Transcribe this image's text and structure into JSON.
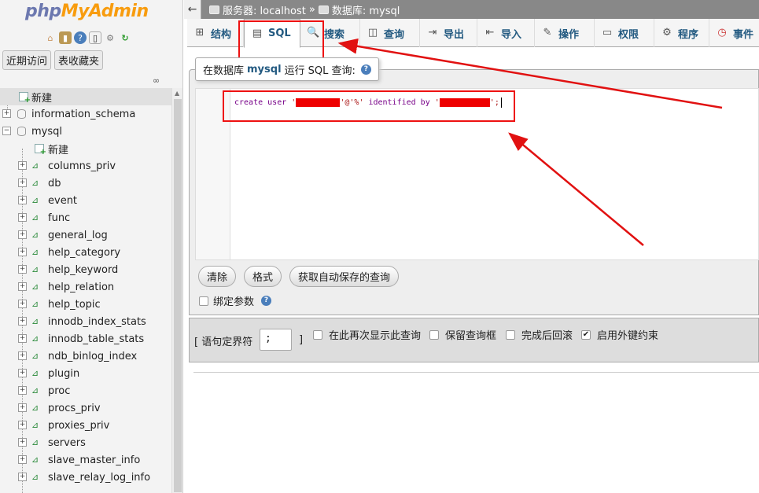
{
  "nav": {
    "logo_php": "php",
    "logo_myadmin": "MyAdmin",
    "recent_button": "近期访问",
    "favorites_button": "表收藏夹",
    "tree": [
      {
        "label": "新建",
        "kind": "new",
        "level": 0
      },
      {
        "label": "information_schema",
        "kind": "db",
        "level": 0
      },
      {
        "label": "mysql",
        "kind": "db",
        "level": 0
      },
      {
        "label": "新建",
        "kind": "new",
        "level": 1
      },
      {
        "label": "columns_priv",
        "kind": "table",
        "level": 1
      },
      {
        "label": "db",
        "kind": "table",
        "level": 1
      },
      {
        "label": "event",
        "kind": "table",
        "level": 1
      },
      {
        "label": "func",
        "kind": "table",
        "level": 1
      },
      {
        "label": "general_log",
        "kind": "table",
        "level": 1
      },
      {
        "label": "help_category",
        "kind": "table",
        "level": 1
      },
      {
        "label": "help_keyword",
        "kind": "table",
        "level": 1
      },
      {
        "label": "help_relation",
        "kind": "table",
        "level": 1
      },
      {
        "label": "help_topic",
        "kind": "table",
        "level": 1
      },
      {
        "label": "innodb_index_stats",
        "kind": "table",
        "level": 1
      },
      {
        "label": "innodb_table_stats",
        "kind": "table",
        "level": 1
      },
      {
        "label": "ndb_binlog_index",
        "kind": "table",
        "level": 1
      },
      {
        "label": "plugin",
        "kind": "table",
        "level": 1
      },
      {
        "label": "proc",
        "kind": "table",
        "level": 1
      },
      {
        "label": "procs_priv",
        "kind": "table",
        "level": 1
      },
      {
        "label": "proxies_priv",
        "kind": "table",
        "level": 1
      },
      {
        "label": "servers",
        "kind": "table",
        "level": 1
      },
      {
        "label": "slave_master_info",
        "kind": "table",
        "level": 1
      },
      {
        "label": "slave_relay_log_info",
        "kind": "table",
        "level": 1
      }
    ]
  },
  "breadcrumb": {
    "server": "服务器: localhost",
    "separator": "»",
    "database": "数据库: mysql"
  },
  "tabs": [
    {
      "label": "结构",
      "icon": "structure-icon",
      "glyph": "⊞"
    },
    {
      "label": "SQL",
      "icon": "sql-icon",
      "glyph": "▤"
    },
    {
      "label": "搜索",
      "icon": "search-icon",
      "glyph": "🔍"
    },
    {
      "label": "查询",
      "icon": "query-icon",
      "glyph": "◫"
    },
    {
      "label": "导出",
      "icon": "export-icon",
      "glyph": "⇥"
    },
    {
      "label": "导入",
      "icon": "import-icon",
      "glyph": "⇤"
    },
    {
      "label": "操作",
      "icon": "wrench-icon",
      "glyph": "✎"
    },
    {
      "label": "权限",
      "icon": "privileges-icon",
      "glyph": "▭"
    },
    {
      "label": "程序",
      "icon": "routines-icon",
      "glyph": "⚙"
    },
    {
      "label": "事件",
      "icon": "events-icon",
      "glyph": "◷"
    }
  ],
  "sql_panel": {
    "legend_prefix": "在数据库",
    "legend_db": "mysql",
    "legend_suffix": "运行 SQL 查询:",
    "code_create": "create",
    "code_user": "user",
    "code_quote": "'",
    "code_host": "'@'%'",
    "code_identified": "identified by",
    "code_end": "';",
    "clear_button": "清除",
    "format_button": "格式",
    "autosave_button": "获取自动保存的查询",
    "bind_params_label": "绑定参数"
  },
  "options": {
    "delimiter_label": "[ 语句定界符",
    "delimiter_value": ";",
    "delimiter_close": "]",
    "show_again": {
      "label": "在此再次显示此查询",
      "checked": false
    },
    "keep_box": {
      "label": "保留查询框",
      "checked": false
    },
    "rollback": {
      "label": "完成后回滚",
      "checked": false
    },
    "foreign_keys": {
      "label": "启用外键约束",
      "checked": true
    }
  },
  "colors": {
    "annotation": "#e11111",
    "link": "#235a81",
    "redaction": "#ee0000"
  }
}
